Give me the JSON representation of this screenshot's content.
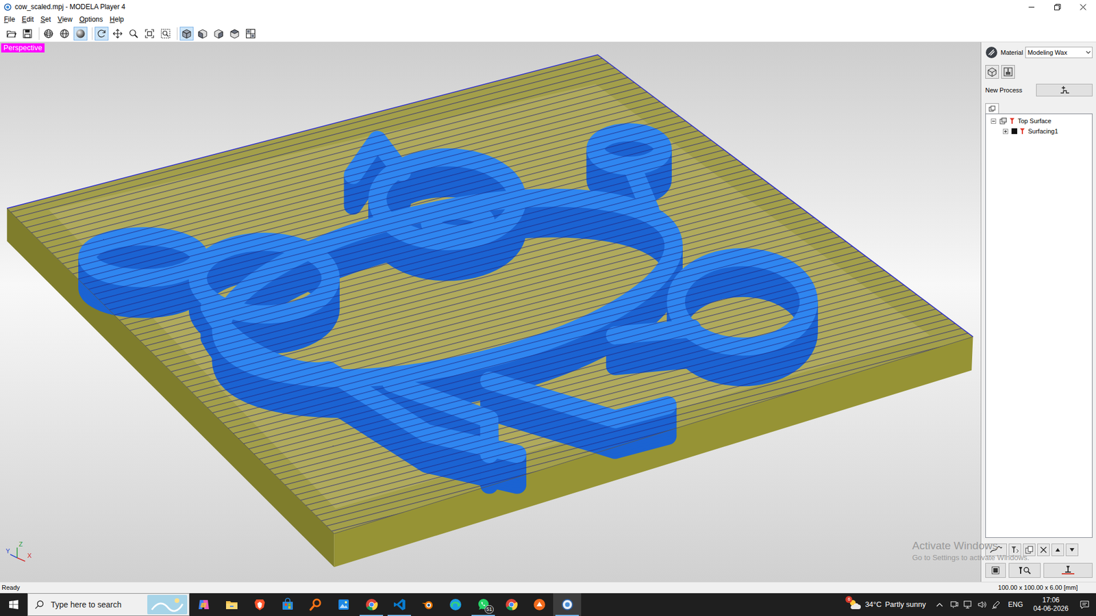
{
  "window": {
    "title": "cow_scaled.mpj - MODELA Player 4"
  },
  "menu": [
    "File",
    "Edit",
    "Set",
    "View",
    "Options",
    "Help"
  ],
  "toolbar": [
    [
      {
        "kind": "open",
        "selected": false
      },
      {
        "kind": "save",
        "selected": false
      }
    ],
    [
      {
        "kind": "wireframe",
        "selected": false
      },
      {
        "kind": "hidden-line",
        "selected": false
      },
      {
        "kind": "shaded",
        "selected": true
      }
    ],
    [
      {
        "kind": "rotate",
        "selected": true
      },
      {
        "kind": "pan",
        "selected": false
      },
      {
        "kind": "zoom",
        "selected": false
      },
      {
        "kind": "fit",
        "selected": false
      },
      {
        "kind": "zoom-box",
        "selected": false
      }
    ],
    [
      {
        "kind": "iso-view",
        "selected": true
      },
      {
        "kind": "front-view",
        "selected": false
      },
      {
        "kind": "right-view",
        "selected": false
      },
      {
        "kind": "left-view",
        "selected": false
      },
      {
        "kind": "multi-view",
        "selected": false
      }
    ]
  ],
  "viewport": {
    "label": "Perspective",
    "axes": {
      "z": "Z",
      "y": "Y",
      "x": "X"
    }
  },
  "side_panel": {
    "material_label": "Material",
    "material": "Modeling Wax",
    "new_process_label": "New Process",
    "tree": [
      {
        "label": "Top Surface",
        "kind": "group",
        "expanded": true,
        "children": [
          {
            "label": "Surfacing1",
            "kind": "process",
            "expanded": false
          }
        ]
      }
    ]
  },
  "watermark": {
    "title": "Activate Windows",
    "subtitle": "Go to Settings to activate Windows."
  },
  "status_bar": {
    "message": "Ready",
    "dimensions": "100.00 x 100.00 x 6.00 [mm]"
  },
  "taskbar": {
    "search_placeholder": "Type here to search",
    "apps": [
      {
        "kind": "copilot",
        "running": false,
        "active": false
      },
      {
        "kind": "explorer",
        "running": false,
        "active": false
      },
      {
        "kind": "brave",
        "running": false,
        "active": false
      },
      {
        "kind": "store",
        "running": false,
        "active": false
      },
      {
        "kind": "search-app",
        "running": false,
        "active": false
      },
      {
        "kind": "paint",
        "running": false,
        "active": false
      },
      {
        "kind": "chrome",
        "running": true,
        "active": false
      },
      {
        "kind": "vscode",
        "running": true,
        "active": false
      },
      {
        "kind": "blender",
        "running": false,
        "active": false
      },
      {
        "kind": "edge",
        "running": false,
        "active": false
      },
      {
        "kind": "whatsapp",
        "running": true,
        "active": false,
        "badge": "51"
      },
      {
        "kind": "chrome",
        "running": false,
        "active": false
      },
      {
        "kind": "app-orange",
        "running": false,
        "active": false
      },
      {
        "kind": "modela",
        "running": true,
        "active": true
      }
    ],
    "weather": {
      "badge": "6",
      "temperature": "34°C",
      "condition": "Partly sunny"
    },
    "language": "ENG",
    "time": "17:06",
    "date": "04-06-2026"
  }
}
